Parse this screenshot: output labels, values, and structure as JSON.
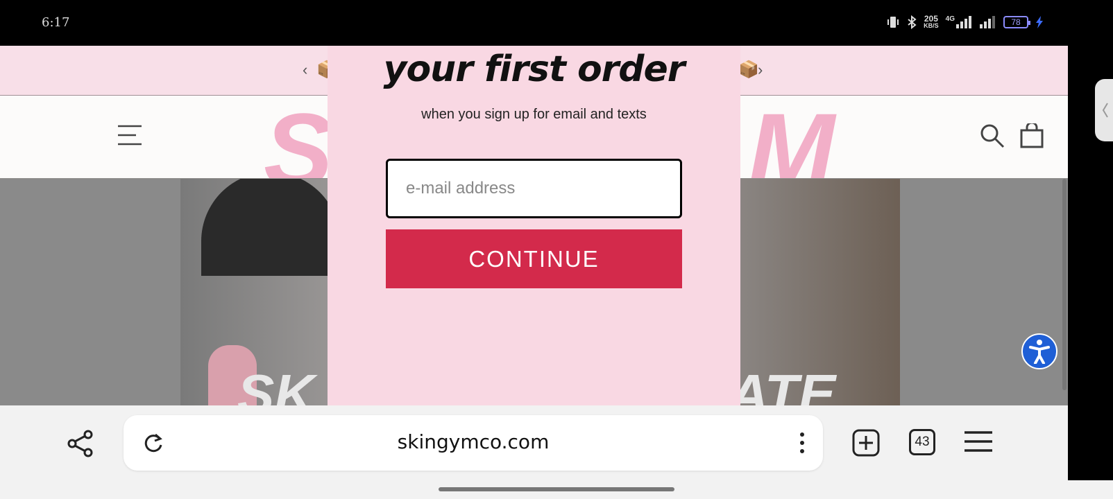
{
  "status_bar": {
    "time": "6:17",
    "net_speed_value": "205",
    "net_speed_unit": "KB/S",
    "network_type": "4G",
    "battery_level": "78"
  },
  "promo_bar": {
    "prev_arrow": "‹",
    "next_arrow": "›",
    "box_emoji": "📦"
  },
  "header": {
    "logo_partial_left": "S",
    "logo_partial_right": "M"
  },
  "hero": {
    "text_left": "SK",
    "text_right": "ATE"
  },
  "modal": {
    "title": "your first order",
    "subtitle": "when you sign up for email and texts",
    "email_placeholder": "e-mail address",
    "continue_label": "CONTINUE"
  },
  "browser": {
    "url": "skingymco.com",
    "tab_count": "43"
  },
  "colors": {
    "modal_bg": "#f9d8e3",
    "continue_button": "#d32a4b",
    "accessibility_button": "#1f5fd6"
  }
}
